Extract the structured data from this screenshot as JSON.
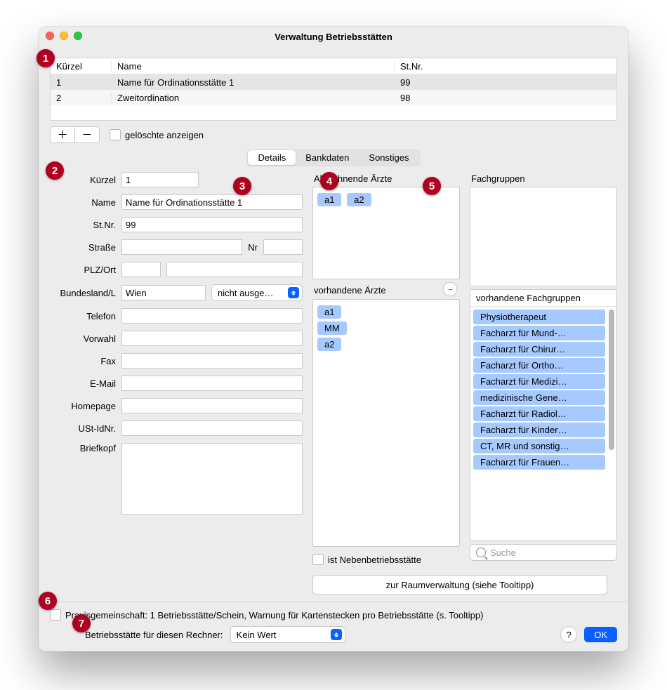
{
  "window": {
    "title": "Verwaltung Betriebsstätten"
  },
  "table": {
    "headers": {
      "kuerzel": "Kürzel",
      "name": "Name",
      "stnr": "St.Nr."
    },
    "rows": [
      {
        "kuerzel": "1",
        "name": "Name für Ordinationsstätte 1",
        "stnr": "99"
      },
      {
        "kuerzel": "2",
        "name": "Zweitordination",
        "stnr": "98"
      }
    ]
  },
  "toolbar": {
    "add": "＋",
    "remove": "－",
    "show_deleted_label": "gelöschte anzeigen"
  },
  "tabs": {
    "details": "Details",
    "bankdaten": "Bankdaten",
    "sonstiges": "Sonstiges"
  },
  "badges": {
    "1": "1",
    "2": "2",
    "3": "3",
    "4": "4",
    "5": "5",
    "6": "6",
    "7": "7"
  },
  "details": {
    "labels": {
      "kuerzel": "Kürzel",
      "name": "Name",
      "stnr": "St.Nr.",
      "strasse": "Straße",
      "nr": "Nr",
      "plzort": "PLZ/Ort",
      "bundesland": "Bundesland/L",
      "telefon": "Telefon",
      "vorwahl": "Vorwahl",
      "fax": "Fax",
      "email": "E-Mail",
      "homepage": "Homepage",
      "ustid": "USt-IdNr.",
      "briefkopf": "Briefkopf"
    },
    "values": {
      "kuerzel": "1",
      "name": "Name für Ordinationsstätte 1",
      "stnr": "99",
      "strasse": "",
      "nr": "",
      "plz": "",
      "ort": "",
      "bundesland": "Wien",
      "land_dropdown": "nicht ausge…",
      "telefon": "",
      "vorwahl": "",
      "fax": "",
      "email": "",
      "homepage": "",
      "ustid": "",
      "briefkopf": ""
    }
  },
  "mid": {
    "abrechnende_title": "Abrechnende Ärzte",
    "abrechnende": [
      "a1",
      "a2"
    ],
    "vorhandene_title": "vorhandene Ärzte",
    "vorhandene": [
      "a1",
      "MM",
      "a2"
    ],
    "neben_label": "ist Nebenbetriebsstätte"
  },
  "right": {
    "fachgruppen_title": "Fachgruppen",
    "vorhandene_fg_header": "vorhandene Fachgruppen",
    "fachgruppen": [
      "Physiotherapeut",
      "Facharzt für Mund-…",
      "Facharzt für Chirur…",
      "Facharzt für Ortho…",
      "Facharzt für Medizi…",
      "medizinische Gene…",
      "Facharzt für Radiol…",
      "Facharzt für Kinder…",
      "CT, MR und sonstig…",
      "Facharzt für Frauen…"
    ],
    "search_placeholder": "Suche"
  },
  "actions": {
    "raumverwaltung": "zur Raumverwaltung (siehe Tooltipp)"
  },
  "footer": {
    "praxis_label": "Praxisgemeinschaft: 1 Betriebsstätte/Schein, Warnung für Kartenstecken pro Betriebsstätte (s. Tooltipp)",
    "rechner_label": "Betriebsstätte für diesen Rechner:",
    "rechner_value": "Kein Wert",
    "help": "?",
    "ok": "OK"
  }
}
